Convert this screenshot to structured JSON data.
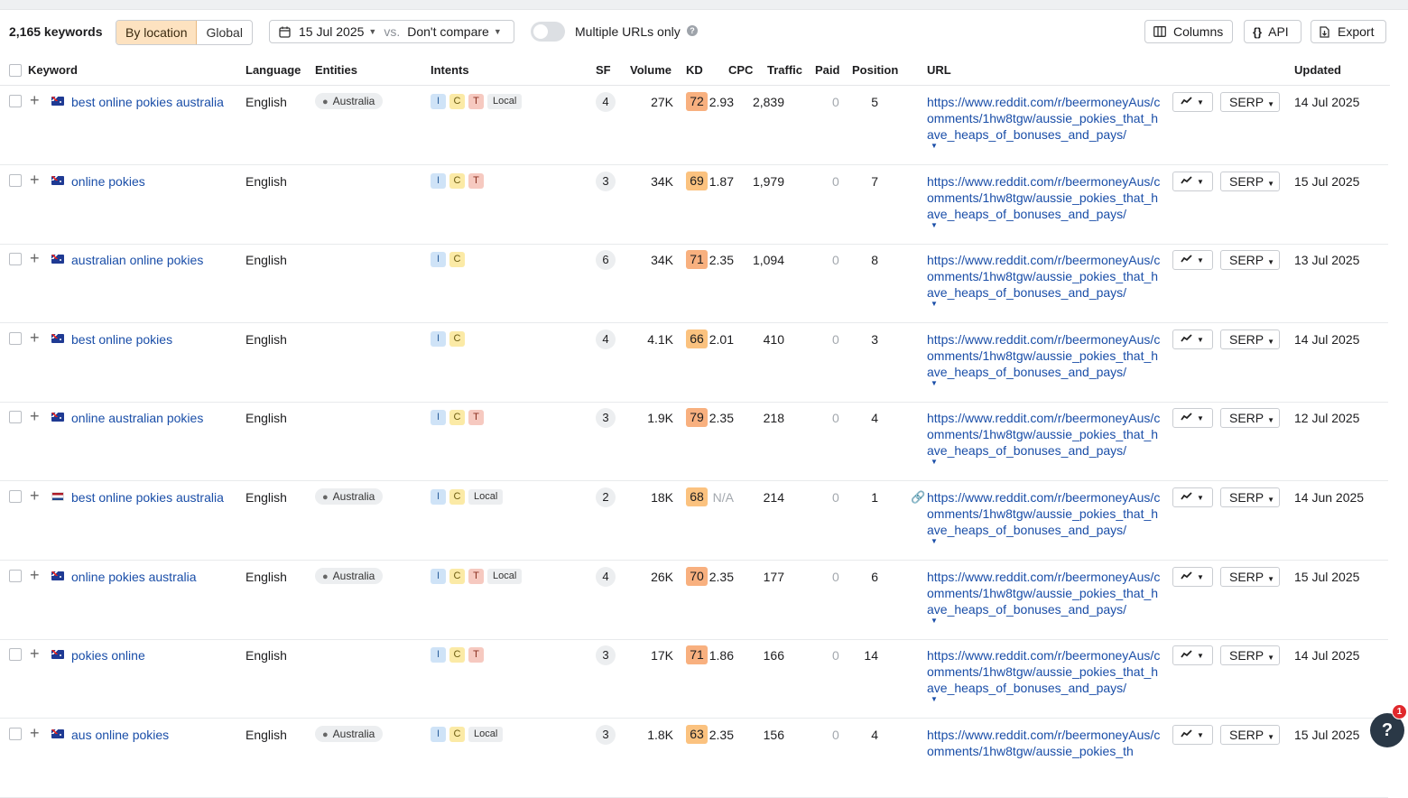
{
  "toolbar": {
    "keyword_count": "2,165 keywords",
    "seg_by_location": "By location",
    "seg_global": "Global",
    "date": "15 Jul 2025",
    "vs": "vs.",
    "compare": "Don't compare",
    "multiple_urls": "Multiple URLs only",
    "help": "?",
    "columns": "Columns",
    "api": "API",
    "export": "Export",
    "api_icon": "{}"
  },
  "columns": {
    "keyword": "Keyword",
    "language": "Language",
    "entities": "Entities",
    "intents": "Intents",
    "sf": "SF",
    "volume": "Volume",
    "kd": "KD",
    "cpc": "CPC",
    "traffic": "Traffic",
    "paid": "Paid",
    "position": "Position",
    "url": "URL",
    "updated": "Updated"
  },
  "colors": {
    "kd_orange_high": "#f8b07f",
    "kd_orange_mid": "#fbc27f",
    "link_blue": "#1a4ea8"
  },
  "rows": [
    {
      "keyword": "best online pokies australia",
      "flag": "au",
      "language": "English",
      "entity": "Australia",
      "intents": [
        "I",
        "C",
        "T",
        "Local"
      ],
      "sf": "4",
      "volume": "27K",
      "kd": "72",
      "cpc": "2.93",
      "traffic": "2,839",
      "paid": "0",
      "position": "5",
      "url": "https://www.reddit.com/r/beermoneyAus/comments/1hw8tgw/aussie_pokies_that_have_heaps_of_bonuses_and_pays/",
      "serp": "SERP",
      "updated": "14 Jul 2025"
    },
    {
      "keyword": "online pokies",
      "flag": "au",
      "language": "English",
      "entity": "",
      "intents": [
        "I",
        "C",
        "T"
      ],
      "sf": "3",
      "volume": "34K",
      "kd": "69",
      "cpc": "1.87",
      "traffic": "1,979",
      "paid": "0",
      "position": "7",
      "url": "https://www.reddit.com/r/beermoneyAus/comments/1hw8tgw/aussie_pokies_that_have_heaps_of_bonuses_and_pays/",
      "serp": "SERP",
      "updated": "15 Jul 2025"
    },
    {
      "keyword": "australian online pokies",
      "flag": "au",
      "language": "English",
      "entity": "",
      "intents": [
        "I",
        "C"
      ],
      "sf": "6",
      "volume": "34K",
      "kd": "71",
      "cpc": "2.35",
      "traffic": "1,094",
      "paid": "0",
      "position": "8",
      "url": "https://www.reddit.com/r/beermoneyAus/comments/1hw8tgw/aussie_pokies_that_have_heaps_of_bonuses_and_pays/",
      "serp": "SERP",
      "updated": "13 Jul 2025"
    },
    {
      "keyword": "best online pokies",
      "flag": "au",
      "language": "English",
      "entity": "",
      "intents": [
        "I",
        "C"
      ],
      "sf": "4",
      "volume": "4.1K",
      "kd": "66",
      "cpc": "2.01",
      "traffic": "410",
      "paid": "0",
      "position": "3",
      "url": "https://www.reddit.com/r/beermoneyAus/comments/1hw8tgw/aussie_pokies_that_have_heaps_of_bonuses_and_pays/",
      "serp": "SERP",
      "updated": "14 Jul 2025"
    },
    {
      "keyword": "online australian pokies",
      "flag": "au",
      "language": "English",
      "entity": "",
      "intents": [
        "I",
        "C",
        "T"
      ],
      "sf": "3",
      "volume": "1.9K",
      "kd": "79",
      "cpc": "2.35",
      "traffic": "218",
      "paid": "0",
      "position": "4",
      "url": "https://www.reddit.com/r/beermoneyAus/comments/1hw8tgw/aussie_pokies_that_have_heaps_of_bonuses_and_pays/",
      "serp": "SERP",
      "updated": "12 Jul 2025"
    },
    {
      "keyword": "best online pokies australia",
      "flag": "nl",
      "language": "English",
      "entity": "Australia",
      "intents": [
        "I",
        "C",
        "Local"
      ],
      "sf": "2",
      "volume": "18K",
      "kd": "68",
      "cpc": "N/A",
      "traffic": "214",
      "paid": "0",
      "position": "1",
      "url": "https://www.reddit.com/r/beermoneyAus/comments/1hw8tgw/aussie_pokies_that_have_heaps_of_bonuses_and_pays/",
      "serp": "SERP",
      "updated": "14 Jun 2025",
      "link": true
    },
    {
      "keyword": "online pokies australia",
      "flag": "au",
      "language": "English",
      "entity": "Australia",
      "intents": [
        "I",
        "C",
        "T",
        "Local"
      ],
      "sf": "4",
      "volume": "26K",
      "kd": "70",
      "cpc": "2.35",
      "traffic": "177",
      "paid": "0",
      "position": "6",
      "url": "https://www.reddit.com/r/beermoneyAus/comments/1hw8tgw/aussie_pokies_that_have_heaps_of_bonuses_and_pays/",
      "serp": "SERP",
      "updated": "15 Jul 2025"
    },
    {
      "keyword": "pokies online",
      "flag": "au",
      "language": "English",
      "entity": "",
      "intents": [
        "I",
        "C",
        "T"
      ],
      "sf": "3",
      "volume": "17K",
      "kd": "71",
      "cpc": "1.86",
      "traffic": "166",
      "paid": "0",
      "position": "14",
      "url": "https://www.reddit.com/r/beermoneyAus/comments/1hw8tgw/aussie_pokies_that_have_heaps_of_bonuses_and_pays/",
      "serp": "SERP",
      "updated": "14 Jul 2025"
    },
    {
      "keyword": "aus online pokies",
      "flag": "au",
      "language": "English",
      "entity": "Australia",
      "intents": [
        "I",
        "C",
        "Local"
      ],
      "sf": "3",
      "volume": "1.8K",
      "kd": "63",
      "cpc": "2.35",
      "traffic": "156",
      "paid": "0",
      "position": "4",
      "url": "https://www.reddit.com/r/beermoneyAus/comments/1hw8tgw/aussie_pokies_th",
      "serp": "SERP",
      "updated": "15 Jul 2025"
    }
  ],
  "help_widget": {
    "label": "?",
    "badge": "1"
  }
}
